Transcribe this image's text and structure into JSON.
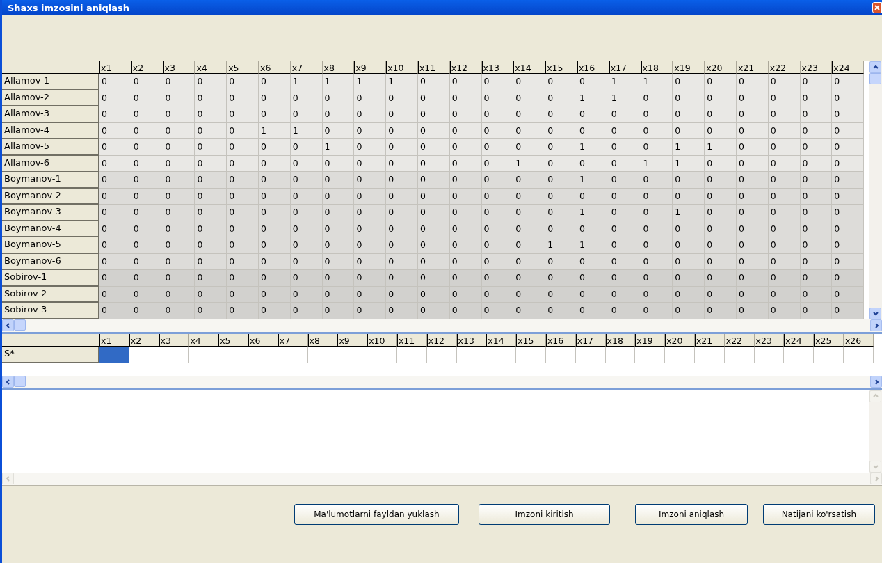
{
  "window": {
    "title": "Shaxs imzosini aniqlash"
  },
  "main_table": {
    "columns": [
      "x1",
      "x2",
      "x3",
      "x4",
      "x5",
      "x6",
      "x7",
      "x8",
      "x9",
      "x10",
      "x11",
      "x12",
      "x13",
      "x14",
      "x15",
      "x16",
      "x17",
      "x18",
      "x19",
      "x20",
      "x21",
      "x22",
      "x23",
      "x24"
    ],
    "rows": [
      {
        "name": "Allamov-1",
        "color": "#e9e8e5",
        "cells": [
          "0",
          "0",
          "0",
          "0",
          "0",
          "0",
          "1",
          "1",
          "1",
          "1",
          "0",
          "0",
          "0",
          "0",
          "0",
          "0",
          "1",
          "1",
          "0",
          "0",
          "0",
          "0",
          "0",
          "0"
        ]
      },
      {
        "name": "Allamov-2",
        "color": "#e9e8e5",
        "cells": [
          "0",
          "0",
          "0",
          "0",
          "0",
          "0",
          "0",
          "0",
          "0",
          "0",
          "0",
          "0",
          "0",
          "0",
          "0",
          "1",
          "1",
          "0",
          "0",
          "0",
          "0",
          "0",
          "0",
          "0"
        ]
      },
      {
        "name": "Allamov-3",
        "color": "#e9e8e5",
        "cells": [
          "0",
          "0",
          "0",
          "0",
          "0",
          "0",
          "0",
          "0",
          "0",
          "0",
          "0",
          "0",
          "0",
          "0",
          "0",
          "0",
          "0",
          "0",
          "0",
          "0",
          "0",
          "0",
          "0",
          "0"
        ]
      },
      {
        "name": "Allamov-4",
        "color": "#e9e8e5",
        "cells": [
          "0",
          "0",
          "0",
          "0",
          "0",
          "1",
          "1",
          "0",
          "0",
          "0",
          "0",
          "0",
          "0",
          "0",
          "0",
          "0",
          "0",
          "0",
          "0",
          "0",
          "0",
          "0",
          "0",
          "0"
        ]
      },
      {
        "name": "Allamov-5",
        "color": "#e9e8e5",
        "cells": [
          "0",
          "0",
          "0",
          "0",
          "0",
          "0",
          "0",
          "1",
          "0",
          "0",
          "0",
          "0",
          "0",
          "0",
          "0",
          "1",
          "0",
          "0",
          "1",
          "1",
          "0",
          "0",
          "0",
          "0"
        ]
      },
      {
        "name": "Allamov-6",
        "color": "#e9e8e5",
        "cells": [
          "0",
          "0",
          "0",
          "0",
          "0",
          "0",
          "0",
          "0",
          "0",
          "0",
          "0",
          "0",
          "0",
          "1",
          "0",
          "0",
          "0",
          "1",
          "1",
          "0",
          "0",
          "0",
          "0",
          "0"
        ]
      },
      {
        "name": "Boymanov-1",
        "color": "#dddcd9",
        "cells": [
          "0",
          "0",
          "0",
          "0",
          "0",
          "0",
          "0",
          "0",
          "0",
          "0",
          "0",
          "0",
          "0",
          "0",
          "0",
          "1",
          "0",
          "0",
          "0",
          "0",
          "0",
          "0",
          "0",
          "0"
        ]
      },
      {
        "name": "Boymanov-2",
        "color": "#dddcd9",
        "cells": [
          "0",
          "0",
          "0",
          "0",
          "0",
          "0",
          "0",
          "0",
          "0",
          "0",
          "0",
          "0",
          "0",
          "0",
          "0",
          "0",
          "0",
          "0",
          "0",
          "0",
          "0",
          "0",
          "0",
          "0"
        ]
      },
      {
        "name": "Boymanov-3",
        "color": "#dddcd9",
        "cells": [
          "0",
          "0",
          "0",
          "0",
          "0",
          "0",
          "0",
          "0",
          "0",
          "0",
          "0",
          "0",
          "0",
          "0",
          "0",
          "1",
          "0",
          "0",
          "1",
          "0",
          "0",
          "0",
          "0",
          "0"
        ]
      },
      {
        "name": "Boymanov-4",
        "color": "#dddcd9",
        "cells": [
          "0",
          "0",
          "0",
          "0",
          "0",
          "0",
          "0",
          "0",
          "0",
          "0",
          "0",
          "0",
          "0",
          "0",
          "0",
          "0",
          "0",
          "0",
          "0",
          "0",
          "0",
          "0",
          "0",
          "0"
        ]
      },
      {
        "name": "Boymanov-5",
        "color": "#dddcd9",
        "cells": [
          "0",
          "0",
          "0",
          "0",
          "0",
          "0",
          "0",
          "0",
          "0",
          "0",
          "0",
          "0",
          "0",
          "0",
          "1",
          "1",
          "0",
          "0",
          "0",
          "0",
          "0",
          "0",
          "0",
          "0"
        ]
      },
      {
        "name": "Boymanov-6",
        "color": "#dddcd9",
        "cells": [
          "0",
          "0",
          "0",
          "0",
          "0",
          "0",
          "0",
          "0",
          "0",
          "0",
          "0",
          "0",
          "0",
          "0",
          "0",
          "0",
          "0",
          "0",
          "0",
          "0",
          "0",
          "0",
          "0",
          "0"
        ]
      },
      {
        "name": "Sobirov-1",
        "color": "#d2d1ce",
        "cells": [
          "0",
          "0",
          "0",
          "0",
          "0",
          "0",
          "0",
          "0",
          "0",
          "0",
          "0",
          "0",
          "0",
          "0",
          "0",
          "0",
          "0",
          "0",
          "0",
          "0",
          "0",
          "0",
          "0",
          "0"
        ]
      },
      {
        "name": "Sobirov-2",
        "color": "#d2d1ce",
        "cells": [
          "0",
          "0",
          "0",
          "0",
          "0",
          "0",
          "0",
          "0",
          "0",
          "0",
          "0",
          "0",
          "0",
          "0",
          "0",
          "0",
          "0",
          "0",
          "0",
          "0",
          "0",
          "0",
          "0",
          "0"
        ]
      },
      {
        "name": "Sobirov-3",
        "color": "#d2d1ce",
        "cells": [
          "0",
          "0",
          "0",
          "0",
          "0",
          "0",
          "0",
          "0",
          "0",
          "0",
          "0",
          "0",
          "0",
          "0",
          "0",
          "0",
          "0",
          "0",
          "0",
          "0",
          "0",
          "0",
          "0",
          "0"
        ]
      }
    ]
  },
  "signature_table": {
    "columns": [
      "x1",
      "x2",
      "x3",
      "x4",
      "x5",
      "x6",
      "x7",
      "x8",
      "x9",
      "x10",
      "x11",
      "x12",
      "x13",
      "x14",
      "x15",
      "x16",
      "x17",
      "x18",
      "x19",
      "x20",
      "x21",
      "x22",
      "x23",
      "x24",
      "x25",
      "x26"
    ],
    "row": {
      "name": "S*",
      "cells": [
        {
          "selected": true
        },
        {
          "selected": false
        },
        {
          "selected": false
        },
        {
          "selected": false
        },
        {
          "selected": false
        },
        {
          "selected": false
        },
        {
          "selected": false
        },
        {
          "selected": false
        },
        {
          "selected": false
        },
        {
          "selected": false
        },
        {
          "selected": false
        },
        {
          "selected": false
        },
        {
          "selected": false
        },
        {
          "selected": false
        },
        {
          "selected": false
        },
        {
          "selected": false
        },
        {
          "selected": false
        },
        {
          "selected": false
        },
        {
          "selected": false
        },
        {
          "selected": false
        },
        {
          "selected": false
        },
        {
          "selected": false
        },
        {
          "selected": false
        },
        {
          "selected": false
        },
        {
          "selected": false
        },
        {
          "selected": false
        }
      ]
    }
  },
  "buttons": [
    "Ma'lumotlarni fayldan yuklash",
    "Imzoni kiritish",
    "Imzoni aniqlash",
    "Natijani ko'rsatish"
  ]
}
